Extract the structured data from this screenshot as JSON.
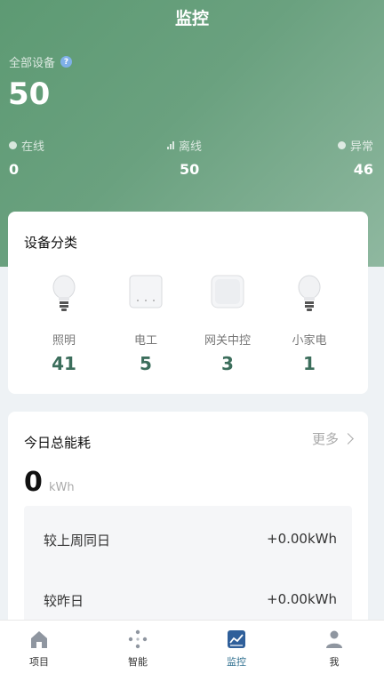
{
  "header": {
    "title": "监控"
  },
  "summary": {
    "all_label": "全部设备",
    "all_count": "50",
    "stats": [
      {
        "label": "在线",
        "value": "0"
      },
      {
        "label": "离线",
        "value": "50"
      },
      {
        "label": "异常",
        "value": "46"
      }
    ]
  },
  "categories": {
    "title": "设备分类",
    "items": [
      {
        "name": "照明",
        "count": "41",
        "icon": "bulb-icon"
      },
      {
        "name": "电工",
        "count": "5",
        "icon": "switch-panel-icon"
      },
      {
        "name": "网关中控",
        "count": "3",
        "icon": "gateway-icon"
      },
      {
        "name": "小家电",
        "count": "1",
        "icon": "small-appliance-icon"
      }
    ]
  },
  "energy": {
    "title": "今日总能耗",
    "more_label": "更多",
    "value": "0",
    "unit": "kWh",
    "compare": [
      {
        "label": "较上周同日",
        "value": "+0.00kWh"
      },
      {
        "label": "较昨日",
        "value": "+0.00kWh"
      }
    ]
  },
  "nav": {
    "items": [
      {
        "label": "项目",
        "icon": "home-icon"
      },
      {
        "label": "智能",
        "icon": "smart-icon"
      },
      {
        "label": "监控",
        "icon": "monitor-chart-icon",
        "active": true
      },
      {
        "label": "我",
        "icon": "user-icon"
      }
    ]
  },
  "colors": {
    "hero_start": "#5d9a73",
    "hero_end": "#8fb8a0",
    "accent_value": "#3c6e5c",
    "nav_active": "#2f6f8f"
  }
}
